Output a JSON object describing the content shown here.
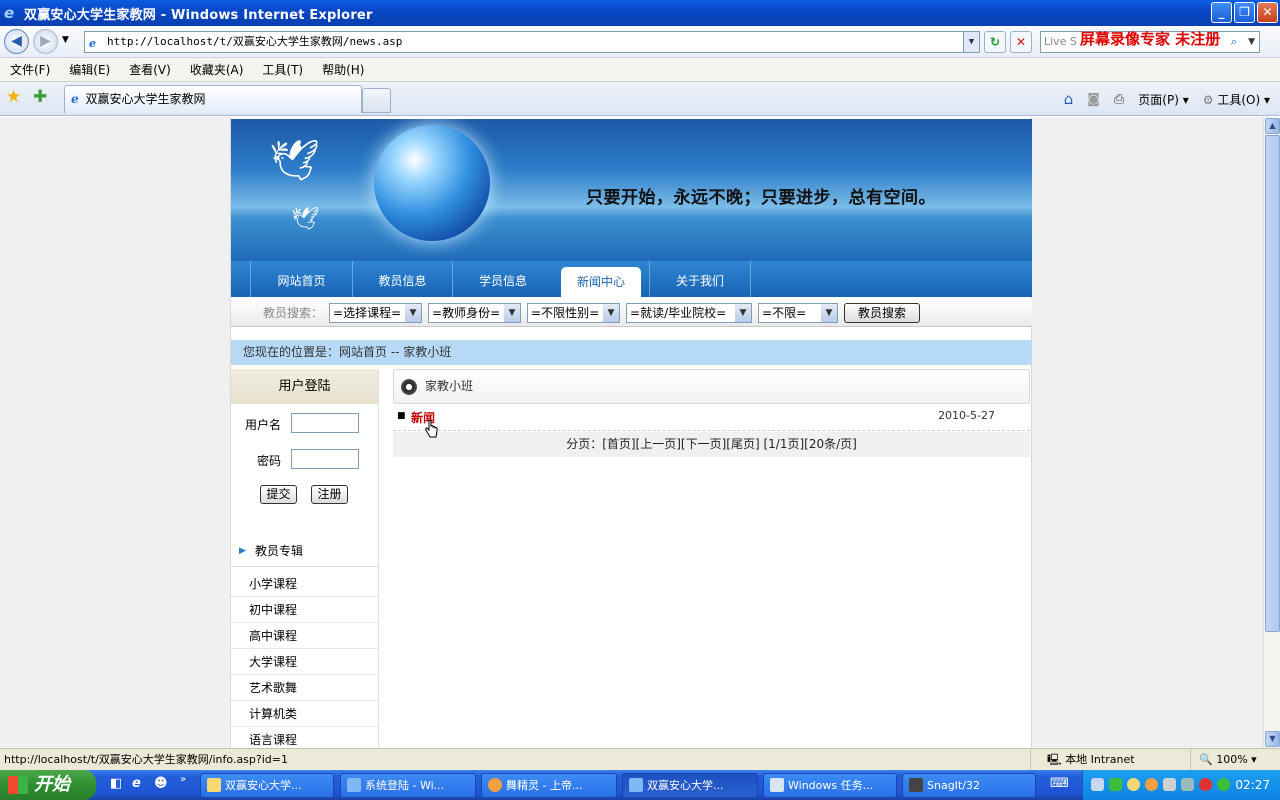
{
  "window": {
    "title": "双赢安心大学生家教网 - Windows Internet Explorer",
    "icon": "ie-icon"
  },
  "address": {
    "url": "http://localhost/t/双赢安心大学生家教网/news.asp",
    "live_search_placeholder": "Live S",
    "watermark": "屏幕录像专家 未注册"
  },
  "menubar": {
    "items": [
      "文件(F)",
      "编辑(E)",
      "查看(V)",
      "收藏夹(A)",
      "工具(T)",
      "帮助(H)"
    ]
  },
  "tabs": {
    "active_tab": "双赢安心大学生家教网",
    "page_label": "页面(P)",
    "tools_label": "工具(O)"
  },
  "page": {
    "slogan": "只要开始，永远不晚；只要进步，总有空间。",
    "nav": [
      "网站首页",
      "教员信息",
      "学员信息",
      "新闻中心",
      "关于我们"
    ],
    "nav_active": "新闻中心",
    "search": {
      "label": "教员搜索：",
      "selects": [
        "=选择课程=",
        "=教师身份=",
        "=不限性别=",
        "=就读/毕业院校=",
        "=不限="
      ],
      "button": "教员搜索"
    },
    "location": "您现在的位置是：网站首页 -- 家教小班",
    "login": {
      "title": "用户登陆",
      "username_label": "用户名",
      "password_label": "密码",
      "submit": "提交",
      "register": "注册"
    },
    "teacher_section": "教员专辑",
    "categories": [
      "小学课程",
      "初中课程",
      "高中课程",
      "大学课程",
      "艺术歌舞",
      "计算机类",
      "语言课程"
    ],
    "main": {
      "heading": "家教小班",
      "news": [
        {
          "title": "新闻",
          "date": "2010-5-27"
        }
      ],
      "pager": "分页：[首页][上一页][下一页][尾页] [1/1页][20条/页]"
    }
  },
  "statusbar": {
    "url": "http://localhost/t/双赢安心大学生家教网/info.asp?id=1",
    "zone": "本地 Intranet",
    "zoom": "100%"
  },
  "taskbar": {
    "start": "开始",
    "tasks": [
      "双赢安心大学...",
      "系统登陆 - Wi...",
      "舞精灵 - 上帝...",
      "双赢安心大学...",
      "Windows 任务...",
      "SnagIt/32"
    ],
    "active_task": "双赢安心大学...",
    "clock": "02:27"
  },
  "colors": {
    "title_bar": "#0848c8",
    "nav_blue": "#1864b4",
    "location_bg": "#b6d9f7",
    "news_link": "#c00000",
    "watermark": "#e00000"
  }
}
